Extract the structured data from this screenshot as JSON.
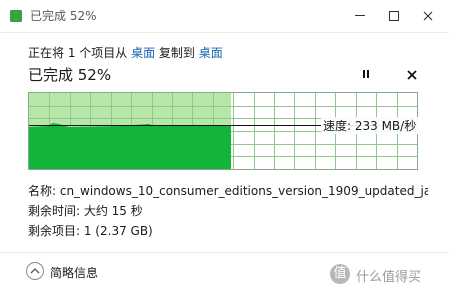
{
  "window": {
    "title": "已完成 52%",
    "controls": [
      "minimize-icon",
      "maximize-icon",
      "close-icon"
    ]
  },
  "copy_line": {
    "prefix": "正在将 1 个项目从 ",
    "source": "桌面",
    "middle": " 复制到 ",
    "destination": "桌面"
  },
  "status": "已完成 52%",
  "buttons": {
    "pause_icon": "pause-icon",
    "cancel_icon": "close-icon"
  },
  "graph": {
    "progress_fraction": 0.52,
    "current_speed_fraction": 0.58,
    "speed_label": "速度: 233 MB/秒",
    "colors": {
      "done_fill": "#b6e6a8",
      "done_bar": "#12b53a",
      "grid": "#8fc98f",
      "speed_line": "#111111",
      "border": "#8aa88a"
    }
  },
  "details": {
    "name": "名称: cn_windows_10_consumer_editions_version_1909_updated_ja...",
    "time_remaining": "剩余时间: 大约 15 秒",
    "items_remaining": "剩余项目: 1 (2.37 GB)"
  },
  "footer": {
    "more_label": "简略信息",
    "more_icon": "chevron-up-icon"
  },
  "watermark": {
    "icon_text": "值",
    "text": "什么值得买"
  }
}
